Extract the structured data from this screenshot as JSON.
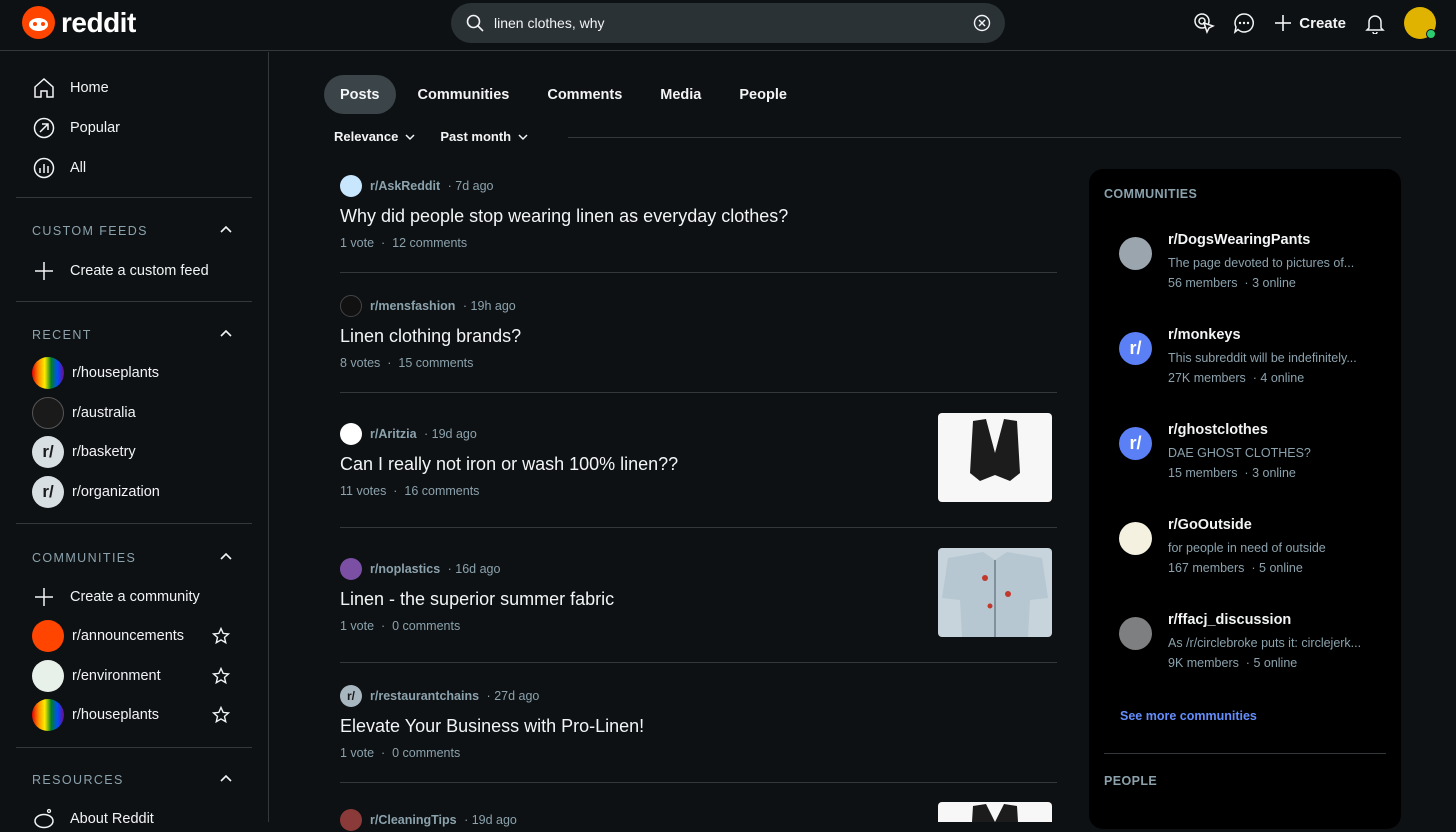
{
  "header": {
    "logo_text": "reddit",
    "search_value": "linen clothes, why",
    "create_label": "Create"
  },
  "sidebar": {
    "nav": [
      {
        "label": "Home",
        "icon": "home-icon"
      },
      {
        "label": "Popular",
        "icon": "popular-icon"
      },
      {
        "label": "All",
        "icon": "all-icon"
      }
    ],
    "custom_feeds": {
      "title": "CUSTOM FEEDS",
      "create_label": "Create a custom feed"
    },
    "recent": {
      "title": "RECENT",
      "items": [
        "r/houseplants",
        "r/australia",
        "r/basketry",
        "r/organization"
      ]
    },
    "communities": {
      "title": "COMMUNITIES",
      "create_label": "Create a community",
      "items": [
        "r/announcements",
        "r/environment",
        "r/houseplants"
      ]
    },
    "resources": {
      "title": "RESOURCES",
      "items": [
        "About Reddit"
      ]
    }
  },
  "main": {
    "tabs": [
      "Posts",
      "Communities",
      "Comments",
      "Media",
      "People"
    ],
    "active_tab": "Posts",
    "sort": "Relevance",
    "time_filter": "Past month",
    "posts": [
      {
        "sub": "r/AskReddit",
        "age": "7d ago",
        "title": "Why did people stop wearing linen as everyday clothes?",
        "votes": "1 vote",
        "comments": "12 comments"
      },
      {
        "sub": "r/mensfashion",
        "age": "19h ago",
        "title": "Linen clothing brands?",
        "votes": "8 votes",
        "comments": "15 comments"
      },
      {
        "sub": "r/Aritzia",
        "age": "19d ago",
        "title": "Can I really not iron or wash 100% linen??",
        "votes": "11 votes",
        "comments": "16 comments"
      },
      {
        "sub": "r/noplastics",
        "age": "16d ago",
        "title": "Linen - the superior summer fabric",
        "votes": "1 vote",
        "comments": "0 comments"
      },
      {
        "sub": "r/restaurantchains",
        "age": "27d ago",
        "title": "Elevate Your Business with Pro-Linen!",
        "votes": "1 vote",
        "comments": "0 comments"
      },
      {
        "sub": "r/CleaningTips",
        "age": "19d ago"
      }
    ]
  },
  "right_panel": {
    "communities_title": "COMMUNITIES",
    "communities": [
      {
        "name": "r/DogsWearingPants",
        "desc": "The page devoted to pictures of...",
        "members": "56 members",
        "online": "3 online"
      },
      {
        "name": "r/monkeys",
        "desc": "This subreddit will be indefinitely...",
        "members": "27K members",
        "online": "4 online"
      },
      {
        "name": "r/ghostclothes",
        "desc": "DAE GHOST CLOTHES?",
        "members": "15 members",
        "online": "3 online"
      },
      {
        "name": "r/GoOutside",
        "desc": "for people in need of outside",
        "members": "167 members",
        "online": "5 online"
      },
      {
        "name": "r/ffacj_discussion",
        "desc": "As /r/circlebroke puts it: circlejerk...",
        "members": "9K members",
        "online": "5 online"
      }
    ],
    "see_more": "See more communities",
    "people_title": "PEOPLE"
  },
  "colors": {
    "accent": "#ff4500",
    "link": "#648efc",
    "background": "#0e1113"
  }
}
